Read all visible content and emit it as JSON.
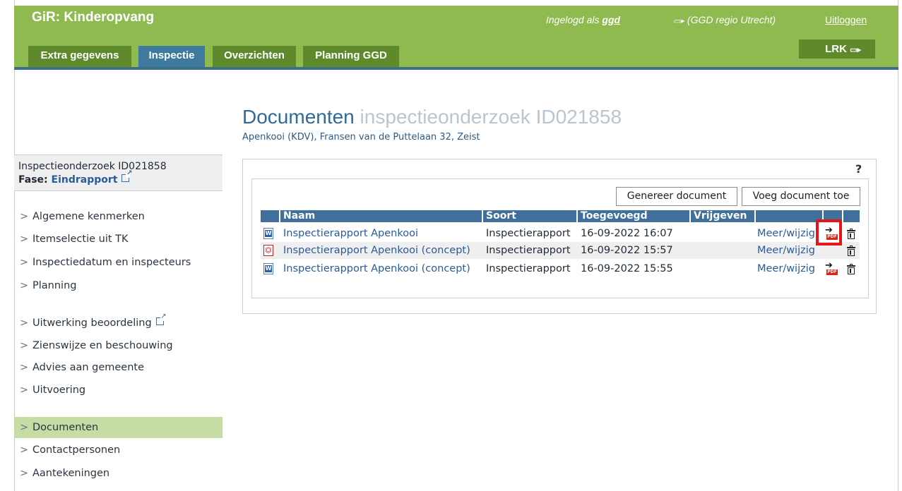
{
  "header": {
    "app_title": "GiR: Kinderopvang",
    "login_prefix": "Ingelogd als ",
    "login_user": "ggd",
    "region_icon": "▭▸",
    "region": "(GGD regio Utrecht)",
    "logout": "Uitloggen",
    "lrk_label": "LRK",
    "lrk_icon": "▭▸",
    "tabs": [
      {
        "label": "Extra gegevens"
      },
      {
        "label": "Inspectie"
      },
      {
        "label": "Overzichten"
      },
      {
        "label": "Planning GGD"
      }
    ],
    "brand_color": "#8fba50",
    "active_tab_color": "#3d7a9e"
  },
  "page": {
    "title_main": "Documenten",
    "title_sub": "inspectieonderzoek ID021858",
    "subtitle": "Apenkooi (KDV), Fransen van de Puttelaan 32, Zeist"
  },
  "sidebar": {
    "header_title": "Inspectieonderzoek ID021858",
    "phase_label": "Fase: ",
    "phase_value": "Eindrapport",
    "items": [
      {
        "label": "Algemene kenmerken"
      },
      {
        "label": "Itemselectie uit TK"
      },
      {
        "label": "Inspectiedatum en inspecteurs"
      },
      {
        "label": "Planning"
      },
      {
        "label": "Uitwerking beoordeling"
      },
      {
        "label": "Zienswijze en beschouwing"
      },
      {
        "label": "Advies aan gemeente"
      },
      {
        "label": "Uitvoering"
      },
      {
        "label": "Documenten"
      },
      {
        "label": "Contactpersonen"
      },
      {
        "label": "Aantekeningen"
      }
    ],
    "active_item": "Documenten",
    "chevron": ">"
  },
  "documents": {
    "help": "?",
    "generate_button": "Genereer document",
    "add_button": "Voeg document toe",
    "columns": [
      "Naam",
      "Soort",
      "Toegevoegd",
      "Vrijgeven"
    ],
    "rows": [
      {
        "icon": "word-doc-icon",
        "name": "Inspectierapport Apenkooi",
        "type": "Inspectierapport",
        "added": "16-09-2022 16:07",
        "release": "",
        "action": "Meer/wijzig",
        "has_pdf_action": true
      },
      {
        "icon": "pdf-doc-icon",
        "name": "Inspectierapport Apenkooi (concept)",
        "type": "Inspectierapport",
        "added": "16-09-2022 15:57",
        "release": "",
        "action": "Meer/wijzig",
        "has_pdf_action": false
      },
      {
        "icon": "word-doc-icon",
        "name": "Inspectierapport Apenkooi (concept)",
        "type": "Inspectierapport",
        "added": "16-09-2022 15:55",
        "release": "",
        "action": "Meer/wijzig",
        "has_pdf_action": true
      }
    ],
    "pdf_badge": "PDF",
    "highlight_color": "#e5141a"
  }
}
